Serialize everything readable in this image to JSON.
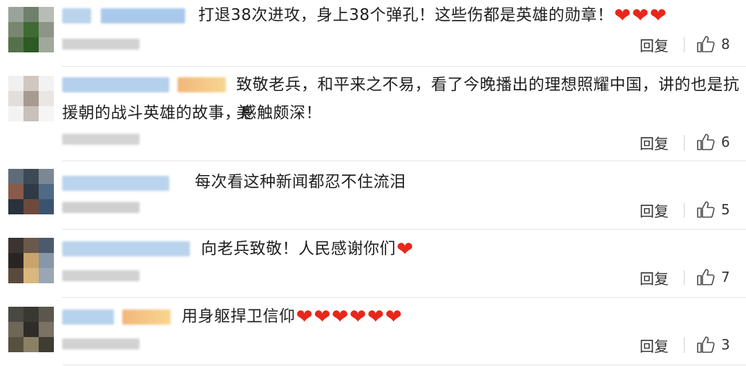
{
  "reply_label": "回复",
  "heart_glyph": "❤",
  "like_icon": "thumbs-up-icon",
  "accent_heart": "#e8271b",
  "comments": [
    {
      "lines": [
        "打退38次进攻，身上38个弹孔！这些伤都是英雄的勋章！"
      ],
      "hearts": 3,
      "likes": "8"
    },
    {
      "lines": [
        "致敬老兵，和平来之不易，看了今晚播出的理想照耀中国，讲的也是抗美",
        "援朝的战斗英雄的故事，感触颇深！"
      ],
      "hearts": 0,
      "likes": "6"
    },
    {
      "lines": [
        "每次看这种新闻都忍不住流泪"
      ],
      "hearts": 0,
      "likes": "5"
    },
    {
      "lines": [
        "向老兵致敬！人民感谢你们"
      ],
      "hearts": 1,
      "likes": "7"
    },
    {
      "lines": [
        "用身躯捍卫信仰"
      ],
      "hearts": 6,
      "likes": "3"
    }
  ]
}
